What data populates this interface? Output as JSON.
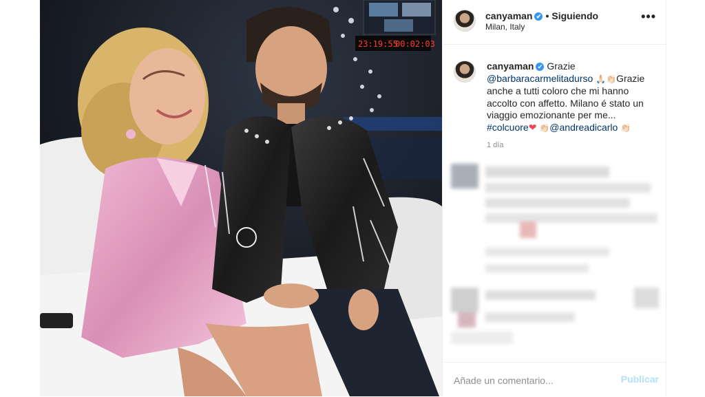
{
  "post": {
    "username": "canyaman",
    "verified_mark": "✔",
    "separator": "•",
    "follow_status": "Siguiendo",
    "location": "Milan, Italy",
    "more_label": "•••"
  },
  "caption": {
    "username": "canyaman",
    "text_1": "Grazie",
    "mention_1": "@barbaracarmelitadurso",
    "emoji_1": "🙏🏻👏🏻",
    "text_2": "Grazie anche a tutti coloro che mi hanno accolto con affetto. Milano é stato un viaggio emozionante per me...",
    "hashtag": "#colcuore",
    "heart": "❤",
    "emoji_2": "👏🏻",
    "mention_2": "@andreadicarlo",
    "emoji_3": "👏🏻",
    "time": "1 día"
  },
  "comment_box": {
    "placeholder": "Añade un comentario...",
    "publish_label": "Publicar"
  },
  "photo": {
    "studio_clock": "23:19:55",
    "studio_timer": "00:02:03"
  },
  "colors": {
    "link": "#003569",
    "verified": "#3897f0",
    "publish_disabled": "#b2dffc",
    "jacket_pink": "#e7a9c8"
  },
  "icons": [
    "verified-icon",
    "more-options-icon",
    "heart-emoji-icon",
    "clap-emoji-icon",
    "pray-emoji-icon"
  ]
}
